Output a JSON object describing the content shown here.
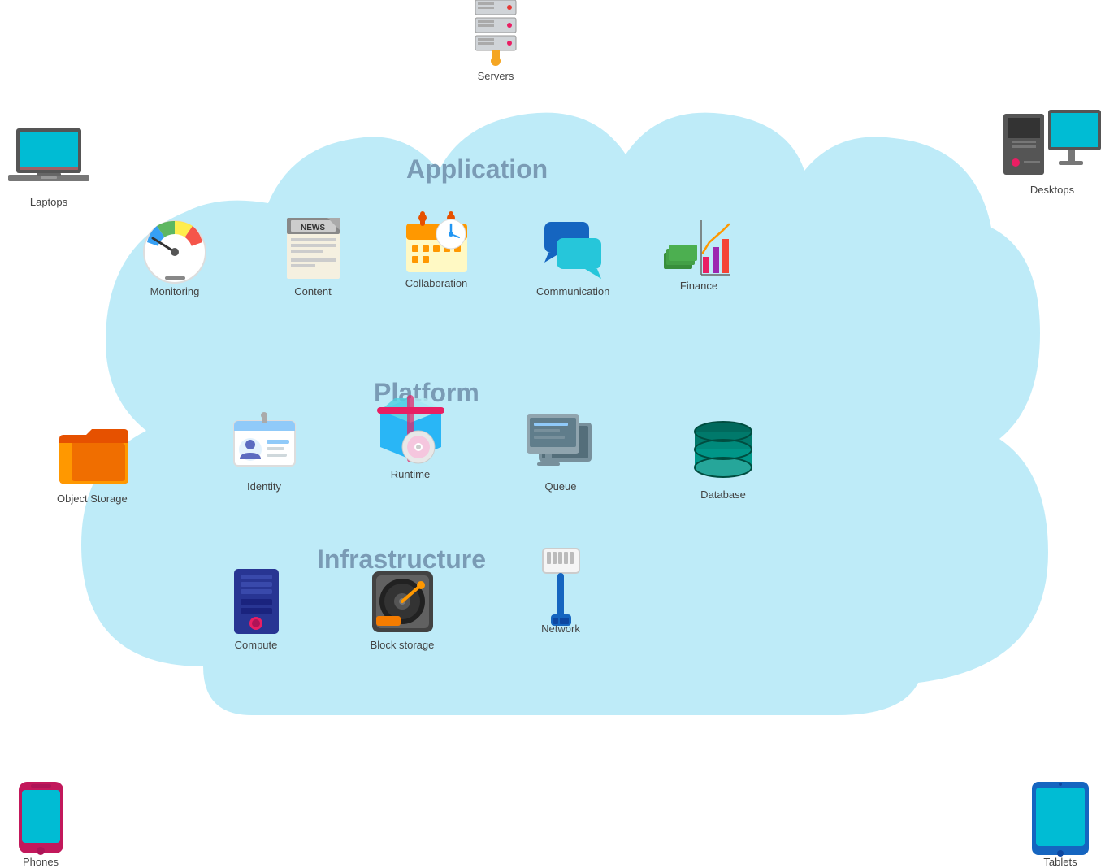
{
  "sections": {
    "application": "Application",
    "platform": "Platform",
    "infrastructure": "Infrastructure"
  },
  "items": {
    "servers": {
      "label": "Servers"
    },
    "laptops": {
      "label": "Laptops"
    },
    "desktops": {
      "label": "Desktops"
    },
    "phones": {
      "label": "Phones"
    },
    "tablets": {
      "label": "Tablets"
    },
    "monitoring": {
      "label": "Monitoring"
    },
    "content": {
      "label": "Content"
    },
    "collaboration": {
      "label": "Collaboration"
    },
    "communication": {
      "label": "Communication"
    },
    "finance": {
      "label": "Finance"
    },
    "identity": {
      "label": "Identity"
    },
    "runtime": {
      "label": "Runtime"
    },
    "queue": {
      "label": "Queue"
    },
    "database": {
      "label": "Database"
    },
    "object_storage": {
      "label": "Object Storage"
    },
    "compute": {
      "label": "Compute"
    },
    "block_storage": {
      "label": "Block storage"
    },
    "network": {
      "label": "Network"
    }
  }
}
